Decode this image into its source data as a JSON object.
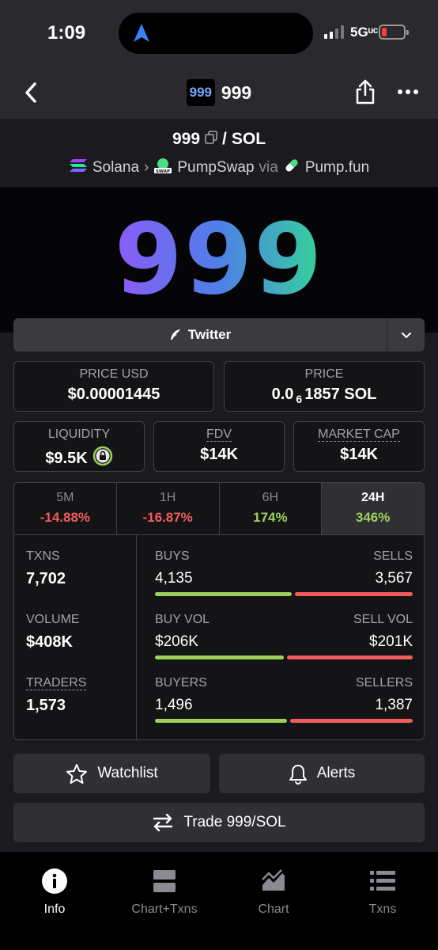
{
  "status_bar": {
    "time": "1:09",
    "network": "5Gᵘᶜ"
  },
  "nav": {
    "token_logo_text": "999",
    "title": "999"
  },
  "pair": {
    "base": "999",
    "separator": "/",
    "quote": "SOL"
  },
  "route": {
    "chain": "Solana",
    "dex": "PumpSwap",
    "via": "via",
    "launchpad": "Pump.fun"
  },
  "banner": {
    "text": "999"
  },
  "twitter": {
    "label": "Twitter"
  },
  "price_usd": {
    "label": "PRICE USD",
    "value": "$0.00001445"
  },
  "price": {
    "label": "PRICE",
    "prefix": "0.0",
    "zeros": "6",
    "suffix": "1857 SOL"
  },
  "liquidity": {
    "label": "LIQUIDITY",
    "value": "$9.5K"
  },
  "fdv": {
    "label": "FDV",
    "value": "$14K"
  },
  "market_cap": {
    "label": "MARKET CAP",
    "value": "$14K"
  },
  "timeframes": [
    {
      "label": "5M",
      "value": "-14.88%",
      "direction": "down"
    },
    {
      "label": "1H",
      "value": "-16.87%",
      "direction": "down"
    },
    {
      "label": "6H",
      "value": "174%",
      "direction": "up"
    },
    {
      "label": "24H",
      "value": "346%",
      "direction": "up",
      "active": true
    }
  ],
  "stats": {
    "txns": {
      "label": "TXNS",
      "value": "7,702"
    },
    "volume": {
      "label": "VOLUME",
      "value": "$408K"
    },
    "traders": {
      "label": "TRADERS",
      "value": "1,573"
    }
  },
  "splits": {
    "buys": {
      "left_label": "BUYS",
      "right_label": "SELLS",
      "left_value": "4,135",
      "right_value": "3,567",
      "buy_fraction": 0.537
    },
    "vol": {
      "left_label": "BUY VOL",
      "right_label": "SELL VOL",
      "left_value": "$206K",
      "right_value": "$201K",
      "buy_fraction": 0.506
    },
    "makers": {
      "left_label": "BUYERS",
      "right_label": "SELLERS",
      "left_value": "1,496",
      "right_value": "1,387",
      "buy_fraction": 0.519
    }
  },
  "actions": {
    "watchlist": "Watchlist",
    "alerts": "Alerts",
    "trade": "Trade 999/SOL"
  },
  "tab_bar": {
    "info": "Info",
    "chart_txns": "Chart+Txns",
    "chart": "Chart",
    "txns": "Txns"
  },
  "colors": {
    "positive": "#9bd15a",
    "negative": "#f25c5c",
    "banner_gradient_start": "#8b5cf6",
    "banner_gradient_end": "#34d399"
  }
}
